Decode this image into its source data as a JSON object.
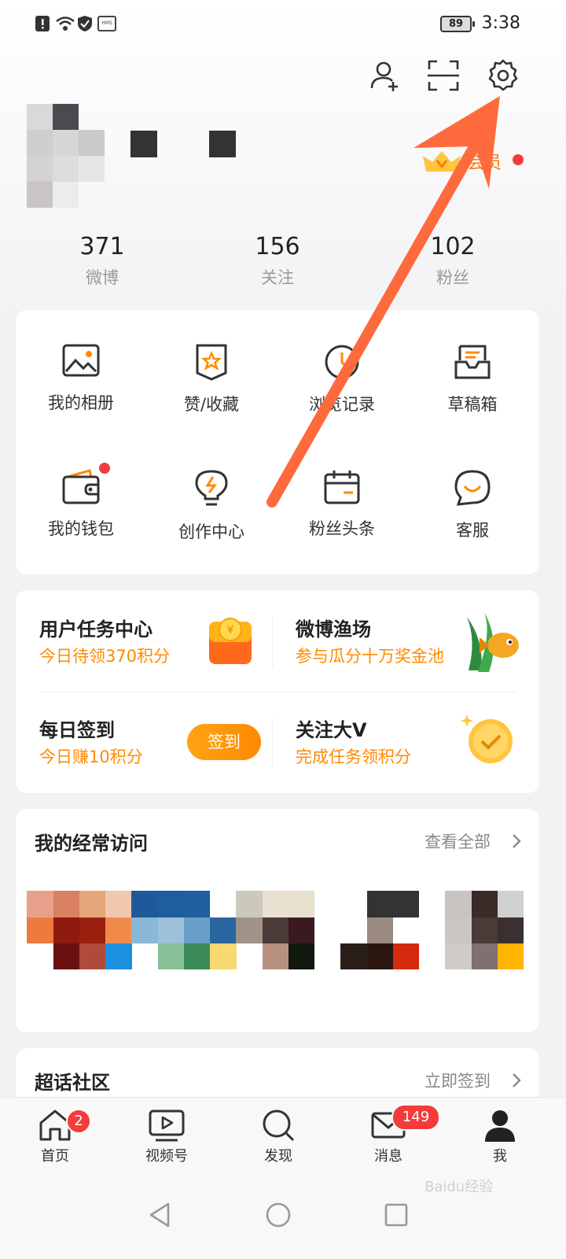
{
  "status": {
    "battery": "89",
    "time": "3:38",
    "hms_label": "HMS"
  },
  "profile": {
    "vip_label": "会员",
    "stats": [
      {
        "num": "371",
        "label": "微博"
      },
      {
        "num": "156",
        "label": "关注"
      },
      {
        "num": "102",
        "label": "粉丝"
      }
    ]
  },
  "grid": [
    {
      "label": "我的相册",
      "icon": "photo-album-icon"
    },
    {
      "label": "赞/收藏",
      "icon": "bookmark-star-icon"
    },
    {
      "label": "浏览记录",
      "icon": "clock-icon"
    },
    {
      "label": "草稿箱",
      "icon": "inbox-tray-icon"
    },
    {
      "label": "我的钱包",
      "icon": "wallet-icon"
    },
    {
      "label": "创作中心",
      "icon": "lightbulb-icon"
    },
    {
      "label": "粉丝头条",
      "icon": "calendar-icon"
    },
    {
      "label": "客服",
      "icon": "chat-smile-icon"
    }
  ],
  "tasks": [
    {
      "title": "用户任务中心",
      "sub": "今日待领370积分"
    },
    {
      "title": "微博渔场",
      "sub": "参与瓜分十万奖金池"
    },
    {
      "title": "每日签到",
      "sub": "今日赚10积分",
      "button": "签到"
    },
    {
      "title": "关注大V",
      "sub": "完成任务领积分"
    }
  ],
  "frequent": {
    "title": "我的经常访问",
    "link": "查看全部"
  },
  "supertopic": {
    "title": "超话社区",
    "link": "立即签到"
  },
  "tabs": [
    {
      "label": "首页",
      "badge": "2"
    },
    {
      "label": "视频号"
    },
    {
      "label": "发现"
    },
    {
      "label": "消息",
      "badge": "149"
    },
    {
      "label": "我"
    }
  ],
  "watermark": "Baidu经验",
  "colors": {
    "accent": "#ff8a00",
    "badge": "#f53b3b",
    "annotation_arrow": "#ff6a3d"
  }
}
